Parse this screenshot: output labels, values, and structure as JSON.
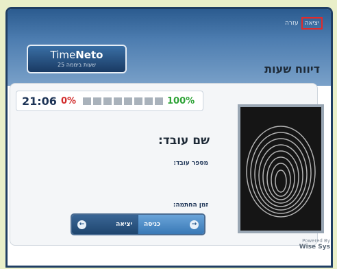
{
  "app": {
    "brand_part1": "Time",
    "brand_part2": "Neto",
    "brand_tagline": "25 שעות ביממה",
    "page_title": "דיווח שעות",
    "top_links": {
      "help": "עזרה",
      "exit": "יציאה"
    }
  },
  "status": {
    "time": "21:06",
    "progress_start_label": "0%",
    "progress_end_label": "100%",
    "progress_value": 0,
    "segments": 8
  },
  "form": {
    "employee_name_label": "שם עובד:",
    "employee_number_label": "מספר עובד:",
    "punch_time_label": "זמן החתמה:"
  },
  "actions": {
    "exit_label": "יציאה",
    "enter_label": "כניסה"
  },
  "footer": {
    "powered_by": "Powered By",
    "company": "Wise Sys"
  },
  "colors": {
    "header": "#2b5b8f",
    "frame": "#1f3e63",
    "progress_low": "#d12b2b",
    "progress_high": "#2ea337"
  },
  "icons": {
    "exit_arrow": "arrow-left-icon",
    "enter_arrow": "arrow-right-icon",
    "fingerprint": "fingerprint-image"
  }
}
